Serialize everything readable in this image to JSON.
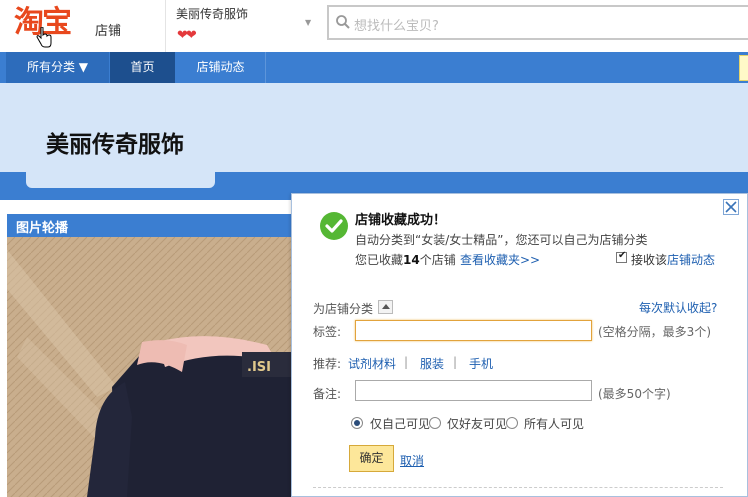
{
  "header": {
    "logo_text": "淘宝",
    "logo_sub": "店铺",
    "shop_name": "美丽传奇服饰",
    "hearts": "❤❤",
    "search_placeholder": "想找什么宝贝?"
  },
  "nav": {
    "all_categories": "所有分类 ▼",
    "home": "首页",
    "shop_dynamics": "店铺动态"
  },
  "banner": {
    "title": "美丽传奇服饰"
  },
  "carousel": {
    "title": "图片轮播"
  },
  "dialog": {
    "success_title": "店铺收藏成功！",
    "success_desc": "自动分类到“女装/女士精品”，您还可以自己为店铺分类",
    "count_prefix": "您已收藏",
    "count": "14",
    "count_suffix": "个店铺",
    "view_favorites": "查看收藏夹>>",
    "receive_prefix": "接收该",
    "receive_link": "店铺动态",
    "receive_checked": true,
    "category_label": "为店铺分类",
    "default_fav_link": "每次默认收起?",
    "tag_label": "标签:",
    "tag_value": "",
    "tag_hint": "(空格分隔，最多3个)",
    "recommend_label": "推荐:",
    "recommend_items": [
      "试剂材料",
      "服装",
      "手机"
    ],
    "note_label": "备注:",
    "note_value": "",
    "note_hint": "(最多50个字)",
    "visibility": {
      "options": [
        "仅自己可见",
        "仅好友可见",
        "所有人可见"
      ],
      "selected": "仅自己可见"
    },
    "ok_button": "确定",
    "cancel_link": "取消"
  }
}
